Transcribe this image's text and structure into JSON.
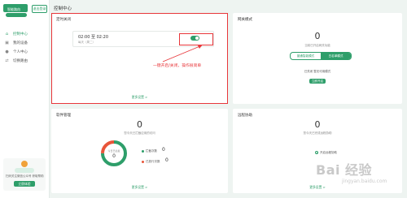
{
  "brand": {
    "logo_text": "智能路由",
    "user_button": "退出登录"
  },
  "sidebar": {
    "items": [
      {
        "label": "控制中心",
        "icon": "home-icon",
        "active": true
      },
      {
        "label": "我的设备",
        "icon": "device-icon",
        "active": false
      },
      {
        "label": "个人中心",
        "icon": "user-icon",
        "active": false
      },
      {
        "label": "切换路由",
        "icon": "switch-icon",
        "active": false
      }
    ],
    "promo_text": "扫码关注微信公众号 获取帮助",
    "promo_button": "立即体验"
  },
  "page_title": "控制中心",
  "timer_card": {
    "title": "定时关闭",
    "time_range": "02:00  至  02:20",
    "days": "每天（周二）",
    "toggle_on": true,
    "annotation": "一键开启/关闭，操作很简单",
    "link": "更多设置 >"
  },
  "network_card": {
    "title": "网关模式",
    "count": "0",
    "sub": "当前已开启网关功能",
    "segments": [
      "普通智能模式",
      "白名单模式"
    ],
    "active_segment": 1,
    "status": "已关闭 暂无可用模式",
    "button": "立即开启"
  },
  "software_card": {
    "title": "软件管理",
    "count": "0",
    "sub": "您今天已拦截应用的访问",
    "donut_label": "今日已拦截",
    "donut_value": "0",
    "legend": [
      {
        "label": "拦截次数",
        "value": "0",
        "color": "#2e9e6a"
      },
      {
        "label": "已放行次数",
        "value": "0",
        "color": "#e8553a"
      }
    ],
    "link": "更多设置 >"
  },
  "remote_card": {
    "title": "远程协助",
    "count": "0",
    "sub": "您今天已完成远程协助",
    "option": "开启远程协助",
    "link": "更多设置 >"
  },
  "watermark": {
    "main": "Bai 经验",
    "sub": "jingyan.baidu.com"
  }
}
